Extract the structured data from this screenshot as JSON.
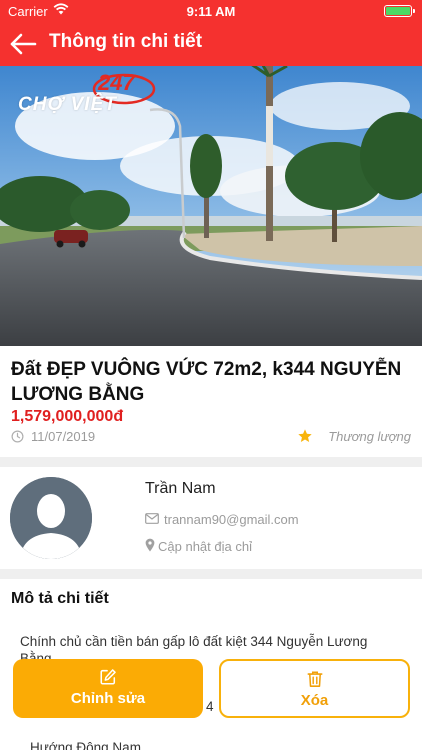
{
  "status_bar": {
    "carrier": "Carrier",
    "time": "9:11 AM"
  },
  "nav": {
    "title": "Thông tin chi tiết",
    "back_icon": "arrow-left-icon"
  },
  "hero": {
    "logo_text": "CHỢ VIỆT",
    "logo_number": "247"
  },
  "listing": {
    "title": "Đất ĐẸP VUÔNG VỨC 72m2, k344 NGUYỄN LƯƠNG BẰNG",
    "price": "1,579,000,000đ",
    "date": "11/07/2019",
    "negotiable": "Thương lượng"
  },
  "seller": {
    "name": "Trần Nam",
    "email": "trannam90@gmail.com",
    "address": "Cập nhật địa chỉ"
  },
  "description": {
    "heading": "Mô tả chi tiết",
    "lines": [
      "Chính chủ cần tiền bán gấp lô đất kiệt 344 Nguyễn Lương",
      "Bằng",
      "4",
      "Hướng Đông Nam"
    ]
  },
  "actions": {
    "edit_label": "Chỉnh sửa",
    "delete_label": "Xóa"
  },
  "colors": {
    "header": "#f5312f",
    "price": "#e01f1f",
    "edit_button": "#fbab05",
    "delete_border": "#f8b10b"
  }
}
